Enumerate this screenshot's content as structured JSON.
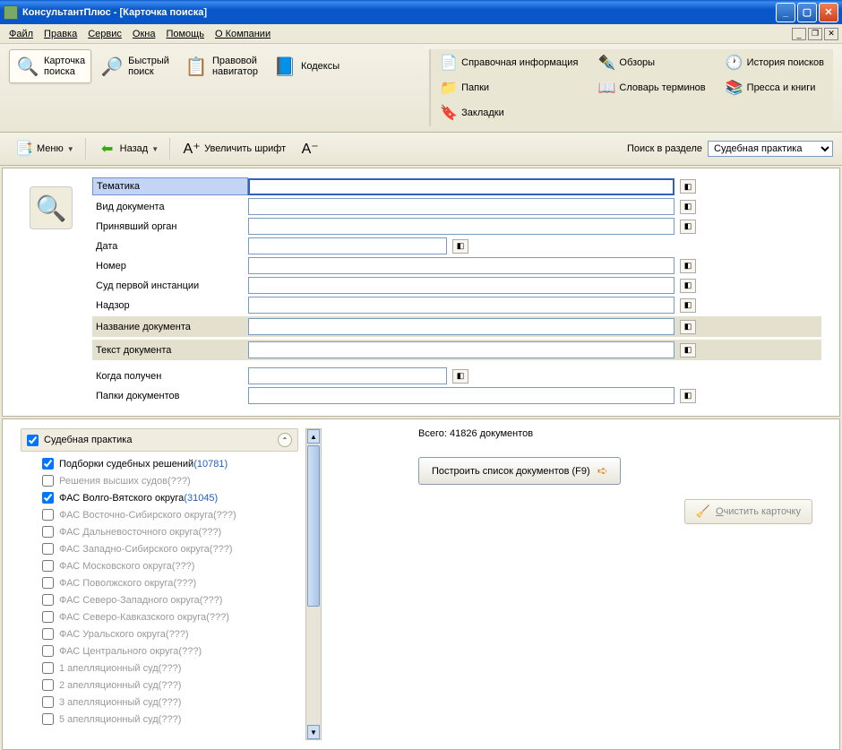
{
  "window": {
    "title": "КонсультантПлюс - [Карточка поиска]"
  },
  "menubar": {
    "file": "Файл",
    "edit": "Правка",
    "service": "Сервис",
    "windows": "Окна",
    "help": "Помощь",
    "about": "О Компании"
  },
  "toolbar": {
    "search_card": "Карточка\nпоиска",
    "quick_search": "Быстрый\nпоиск",
    "legal_nav": "Правовой\nнавигатор",
    "codex": "Кодексы",
    "ref_info": "Справочная информация",
    "reviews": "Обзоры",
    "folders": "Папки",
    "history": "История поисков",
    "dictionary": "Словарь терминов",
    "press": "Пресса и книги",
    "bookmarks": "Закладки"
  },
  "secondbar": {
    "menu": "Меню",
    "back": "Назад",
    "zoom_in": "Увеличить шрифт",
    "search_in": "Поиск в разделе",
    "section_value": "Судебная практика"
  },
  "form": {
    "topic": "Тематика",
    "doc_type": "Вид документа",
    "adopted_by": "Принявший орган",
    "date": "Дата",
    "number": "Номер",
    "first_court": "Суд первой инстанции",
    "supervision": "Надзор",
    "doc_name": "Название документа",
    "doc_text": "Текст документа",
    "when_received": "Когда получен",
    "doc_folders": "Папки документов"
  },
  "tree": {
    "root": "Судебная практика",
    "items": [
      {
        "label": "Подборки судебных решений",
        "count": "(10781)",
        "checked": true,
        "dim": false
      },
      {
        "label": "Решения высших судов",
        "count": "(???)",
        "checked": false,
        "dim": true
      },
      {
        "label": "ФАС Волго-Вятского округа",
        "count": "(31045)",
        "checked": true,
        "dim": false
      },
      {
        "label": "ФАС Восточно-Сибирского округа",
        "count": "(???)",
        "checked": false,
        "dim": true
      },
      {
        "label": "ФАС Дальневосточного округа",
        "count": "(???)",
        "checked": false,
        "dim": true
      },
      {
        "label": "ФАС Западно-Сибирского округа",
        "count": "(???)",
        "checked": false,
        "dim": true
      },
      {
        "label": "ФАС Московского округа",
        "count": "(???)",
        "checked": false,
        "dim": true
      },
      {
        "label": "ФАС Поволжского округа",
        "count": "(???)",
        "checked": false,
        "dim": true
      },
      {
        "label": "ФАС Северо-Западного округа",
        "count": "(???)",
        "checked": false,
        "dim": true
      },
      {
        "label": "ФАС Северо-Кавказского округа",
        "count": "(???)",
        "checked": false,
        "dim": true
      },
      {
        "label": "ФАС Уральского округа",
        "count": "(???)",
        "checked": false,
        "dim": true
      },
      {
        "label": "ФАС Центрального округа",
        "count": "(???)",
        "checked": false,
        "dim": true
      },
      {
        "label": "1 апелляционный суд",
        "count": "(???)",
        "checked": false,
        "dim": true
      },
      {
        "label": "2 апелляционный суд",
        "count": "(???)",
        "checked": false,
        "dim": true
      },
      {
        "label": "3 апелляционный суд",
        "count": "(???)",
        "checked": false,
        "dim": true
      },
      {
        "label": "5 апелляционный суд",
        "count": "(???)",
        "checked": false,
        "dim": true
      }
    ]
  },
  "results": {
    "total_prefix": "Всего: ",
    "total_count": "41826",
    "total_suffix": " документов",
    "build_btn": "Построить список документов (F9)",
    "clear_btn_pre": "О",
    "clear_btn_rest": "чистить карточку"
  }
}
